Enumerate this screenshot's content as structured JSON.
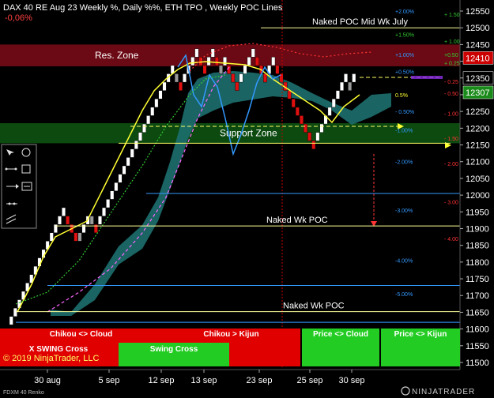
{
  "header": {
    "title": "DAX 40 RE Aug 23 Weekly %, Daily %%, ETH TPO , Weekly POC Lines",
    "change": "-0,06%"
  },
  "footer": {
    "copyright": "© 2019 NinjaTrader, LLC",
    "series_label": "FDXM 40 Renko",
    "brand": "NINJATRADER"
  },
  "colors": {
    "background": "#000000",
    "bull_brick": "#ffffff",
    "bear_brick": "#e01010",
    "neutral_brick": "#9a9a9a",
    "res_zone": "#6b0a14",
    "support_zone": "#0c4a10",
    "cloud": "#1d6f6f",
    "tenkan": "#ffff33",
    "kijun": "#3399ff",
    "ma_green": "#33cc33",
    "ma_magenta": "#ff66ff",
    "ma_red": "#ff3333",
    "poc_line": "#ffff99",
    "pct_line": "#3399ff",
    "red_panel": "#e00000",
    "green_panel": "#22cc22"
  },
  "chart_data": {
    "type": "renko",
    "yticks": [
      12550,
      12500,
      12450,
      12400,
      12350,
      12300,
      12250,
      12200,
      12150,
      12100,
      12050,
      12000,
      11950,
      11900,
      11850,
      11800,
      11750,
      11700,
      11650,
      11600,
      11550,
      11500
    ],
    "ylim": [
      11490,
      12570
    ],
    "xticks": [
      "30 aug",
      "5 sep",
      "12 sep",
      "13 sep",
      "23 sep",
      "25 sep",
      "30 sep"
    ],
    "price_labels": [
      {
        "value": 12410,
        "text": "12410",
        "style": "red"
      },
      {
        "value": 12350,
        "text": "12350",
        "style": "black"
      },
      {
        "value": 12307,
        "text": "12307",
        "style": "green"
      }
    ],
    "zones": [
      {
        "name": "Res. Zone",
        "from": 12385,
        "to": 12450
      },
      {
        "name": "Support Zone",
        "from": 12155,
        "to": 12215
      }
    ],
    "levels": [
      {
        "label": "Naked POC Mid Wk July",
        "value": 12500
      },
      {
        "label": "Naked Wk POC",
        "value": 11908
      },
      {
        "label": "Naked Wk POC",
        "value": 11652
      }
    ],
    "pct_levels": [
      {
        "label": "+2.00%",
        "value": 12550,
        "color": "#3399ff"
      },
      {
        "label": "+1.50%",
        "value": 12480,
        "color": "#33cc33"
      },
      {
        "label": "+1.00%",
        "value": 12420,
        "color": "#3399ff"
      },
      {
        "label": "+0.50%",
        "value": 12370,
        "color": "#3399ff"
      },
      {
        "label": "0.5%",
        "value": 12300,
        "color": "#ffff33"
      },
      {
        "label": "- 0.50%",
        "value": 12250,
        "color": "#3399ff"
      },
      {
        "label": "-1.00%",
        "value": 12195,
        "color": "#3399ff"
      },
      {
        "label": "-2.00%",
        "value": 12100,
        "color": "#3399ff"
      },
      {
        "label": "-3.00%",
        "value": 11955,
        "color": "#3399ff"
      },
      {
        "label": "-4.00%",
        "value": 11805,
        "color": "#3399ff"
      },
      {
        "label": "-5.00%",
        "value": 11705,
        "color": "#3399ff"
      }
    ],
    "daily_pct": [
      {
        "label": "+ 1.50",
        "value": 12540,
        "color": "#33cc33"
      },
      {
        "label": "+ 1.00",
        "value": 12460,
        "color": "#33cc33"
      },
      {
        "label": "+0.50",
        "value": 12420,
        "color": "#33cc33"
      },
      {
        "label": "+ 0.25",
        "value": 12395,
        "color": "#33cc33"
      },
      {
        "label": "- 0.25",
        "value": 12340,
        "color": "#ff3333"
      },
      {
        "label": "- 0.50",
        "value": 12305,
        "color": "#ff3333"
      },
      {
        "label": "- 1.00",
        "value": 12245,
        "color": "#ff3333"
      },
      {
        "label": "- 1.50",
        "value": 12170,
        "color": "#ff3333"
      },
      {
        "label": "- 2.00",
        "value": 12095,
        "color": "#ff3333"
      },
      {
        "label": "- 3.00",
        "value": 11980,
        "color": "#ff3333"
      },
      {
        "label": "- 4.00",
        "value": 11870,
        "color": "#ff3333"
      }
    ],
    "bricks": [
      [
        11625,
        "bull"
      ],
      [
        11650,
        "bull"
      ],
      [
        11675,
        "bull"
      ],
      [
        11700,
        "bull"
      ],
      [
        11725,
        "bull"
      ],
      [
        11750,
        "bull"
      ],
      [
        11775,
        "bull"
      ],
      [
        11800,
        "bull"
      ],
      [
        11825,
        "bull"
      ],
      [
        11850,
        "bull"
      ],
      [
        11875,
        "bull"
      ],
      [
        11900,
        "bull"
      ],
      [
        11925,
        "bull"
      ],
      [
        11950,
        "bull"
      ],
      [
        11925,
        "bear"
      ],
      [
        11900,
        "bear"
      ],
      [
        11875,
        "bear"
      ],
      [
        11875,
        "neutral"
      ],
      [
        11900,
        "bull"
      ],
      [
        11925,
        "bull"
      ],
      [
        11925,
        "neutral"
      ],
      [
        11900,
        "bear"
      ],
      [
        11925,
        "bull"
      ],
      [
        11950,
        "bull"
      ],
      [
        11975,
        "bull"
      ],
      [
        12000,
        "bull"
      ],
      [
        12025,
        "bull"
      ],
      [
        12050,
        "bull"
      ],
      [
        12075,
        "bull"
      ],
      [
        12100,
        "bull"
      ],
      [
        12125,
        "bull"
      ],
      [
        12150,
        "bull"
      ],
      [
        12175,
        "bull"
      ],
      [
        12200,
        "bull"
      ],
      [
        12225,
        "bull"
      ],
      [
        12250,
        "bull"
      ],
      [
        12275,
        "bull"
      ],
      [
        12300,
        "bull"
      ],
      [
        12325,
        "bull"
      ],
      [
        12350,
        "bull"
      ],
      [
        12375,
        "bull"
      ],
      [
        12350,
        "neutral"
      ],
      [
        12325,
        "bear"
      ],
      [
        12350,
        "bull"
      ],
      [
        12375,
        "bull"
      ],
      [
        12400,
        "bull"
      ],
      [
        12425,
        "bull"
      ],
      [
        12400,
        "bear"
      ],
      [
        12375,
        "bear"
      ],
      [
        12400,
        "bull"
      ],
      [
        12425,
        "bull"
      ],
      [
        12400,
        "bear"
      ],
      [
        12375,
        "neutral"
      ],
      [
        12400,
        "bull"
      ],
      [
        12375,
        "bear"
      ],
      [
        12350,
        "bear"
      ],
      [
        12325,
        "bear"
      ],
      [
        12350,
        "bull"
      ],
      [
        12375,
        "bull"
      ],
      [
        12400,
        "bull"
      ],
      [
        12425,
        "bull"
      ],
      [
        12400,
        "bear"
      ],
      [
        12375,
        "bear"
      ],
      [
        12350,
        "bear"
      ],
      [
        12375,
        "bull"
      ],
      [
        12400,
        "bull"
      ],
      [
        12375,
        "bear"
      ],
      [
        12350,
        "bear"
      ],
      [
        12325,
        "bear"
      ],
      [
        12300,
        "bear"
      ],
      [
        12275,
        "bear"
      ],
      [
        12250,
        "bear"
      ],
      [
        12225,
        "bear"
      ],
      [
        12200,
        "bear"
      ],
      [
        12175,
        "bear"
      ],
      [
        12150,
        "bear"
      ],
      [
        12175,
        "bull"
      ],
      [
        12200,
        "bull"
      ],
      [
        12225,
        "bull"
      ],
      [
        12250,
        "bull"
      ],
      [
        12275,
        "bull"
      ],
      [
        12300,
        "bull"
      ],
      [
        12325,
        "bull"
      ],
      [
        12350,
        "bull"
      ],
      [
        12325,
        "neutral"
      ],
      [
        12350,
        "bull"
      ]
    ],
    "panels_top": [
      {
        "label": "Chikou <> Cloud",
        "color": "red"
      },
      {
        "label": "Chikou > Kijun",
        "color": "red"
      },
      {
        "label": "Price <> Cloud",
        "color": "green"
      },
      {
        "label": "Price <> Kijun",
        "color": "green"
      }
    ],
    "panels_bottom": [
      {
        "label": "X SWING Cross",
        "color": "red"
      },
      {
        "label": "Swing Cross",
        "color": "green"
      }
    ]
  }
}
